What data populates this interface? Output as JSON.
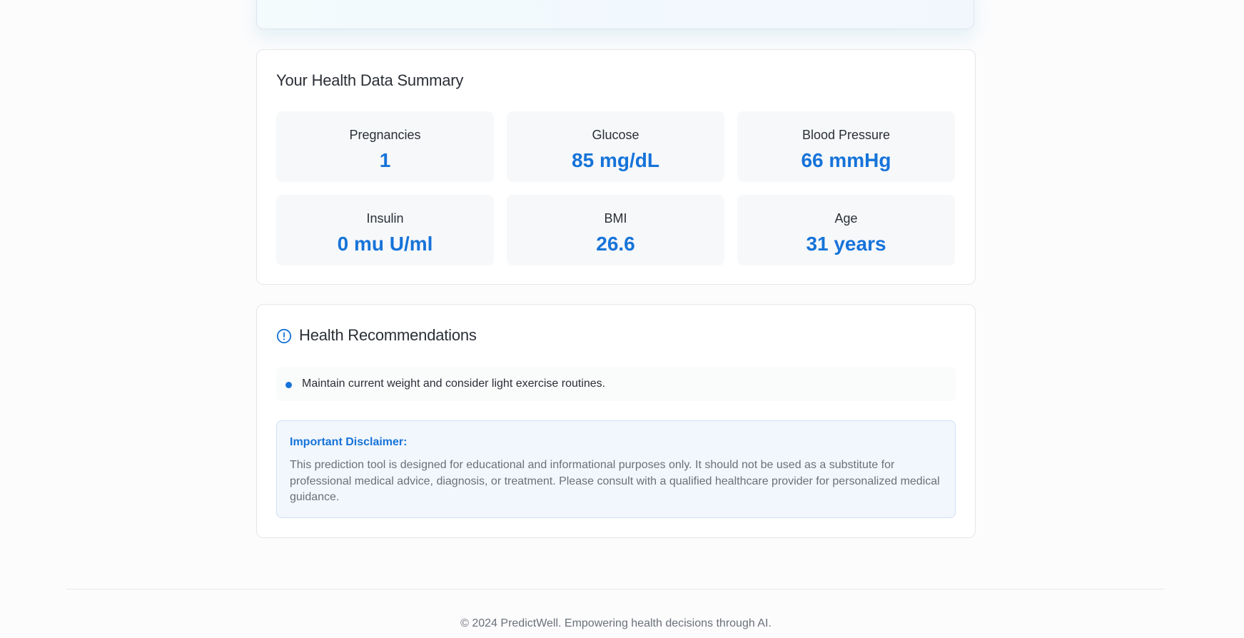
{
  "summary": {
    "title": "Your Health Data Summary",
    "stats": [
      {
        "label": "Pregnancies",
        "value": "1"
      },
      {
        "label": "Glucose",
        "value": "85 mg/dL"
      },
      {
        "label": "Blood Pressure",
        "value": "66 mmHg"
      },
      {
        "label": "Insulin",
        "value": "0 mu U/ml"
      },
      {
        "label": "BMI",
        "value": "26.6"
      },
      {
        "label": "Age",
        "value": "31 years"
      }
    ]
  },
  "recommendations": {
    "title": "Health Recommendations",
    "icon": "info-circle-icon",
    "items": [
      {
        "text": "Maintain current weight and consider light exercise routines."
      }
    ],
    "disclaimer": {
      "title": "Important Disclaimer:",
      "text": "This prediction tool is designed for educational and informational purposes only. It should not be used as a substitute for professional medical advice, diagnosis, or treatment. Please consult with a qualified healthcare provider for personalized medical guidance."
    }
  },
  "footer": {
    "text": "© 2024 PredictWell. Empowering health decisions through AI."
  },
  "colors": {
    "accent": "#1673d9",
    "text": "#2b2f36",
    "muted": "#6b7079",
    "stat_bg": "#f6f8fa",
    "disclaimer_bg": "#f2f7fd"
  }
}
